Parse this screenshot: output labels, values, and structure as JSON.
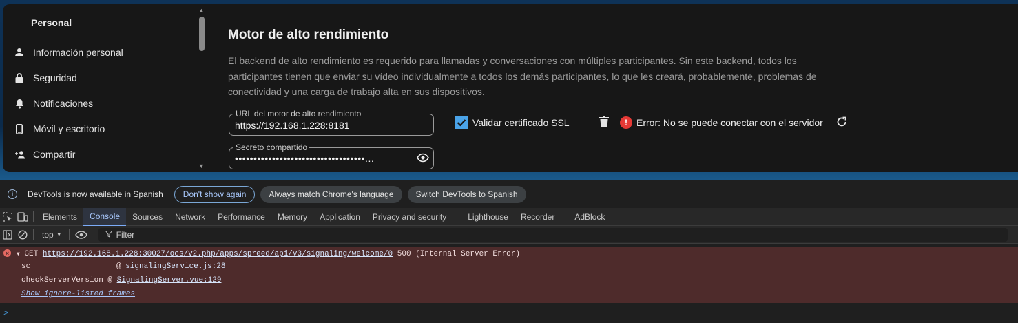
{
  "sidebar": {
    "title": "Personal",
    "items": [
      {
        "label": "Información personal",
        "icon": "user-icon"
      },
      {
        "label": "Seguridad",
        "icon": "lock-icon"
      },
      {
        "label": "Notificaciones",
        "icon": "bell-icon"
      },
      {
        "label": "Móvil y escritorio",
        "icon": "phone-icon"
      },
      {
        "label": "Compartir",
        "icon": "user-plus-icon"
      }
    ]
  },
  "main": {
    "title": "Motor de alto rendimiento",
    "description": "El backend de alto rendimiento es requerido para llamadas y conversaciones con múltiples participantes. Sin este backend, todos los participantes tienen que enviar su vídeo individualmente a todos los demás participantes, lo que les creará, probablemente, problemas de conectividad y una carga de trabajo alta en sus dispositivos.",
    "url_field": {
      "label": "URL del motor de alto rendimiento",
      "value": "https://192.168.1.228:8181"
    },
    "secret_field": {
      "label": "Secreto compartido",
      "value": "•••••••••••••••••••••••••••••••••••..."
    },
    "ssl_checkbox": {
      "label": "Validar certificado SSL",
      "checked": true
    },
    "error_text": "Error: No se puede conectar con el servidor"
  },
  "devtools": {
    "infobar": {
      "text": "DevTools is now available in Spanish",
      "dont_show": "Don't show again",
      "always_match": "Always match Chrome's language",
      "switch": "Switch DevTools to Spanish"
    },
    "tabs": [
      "Elements",
      "Console",
      "Sources",
      "Network",
      "Performance",
      "Memory",
      "Application",
      "Privacy and security",
      "Lighthouse",
      "Recorder",
      "AdBlock"
    ],
    "active_tab": "Console",
    "context": "top",
    "filter_placeholder": "Filter",
    "error": {
      "method": "GET",
      "url": "https://192.168.1.228:30027/ocs/v2.php/apps/spreed/api/v3/signaling/welcome/0",
      "status": "500 (Internal Server Error)",
      "frames": [
        {
          "fn": "sc",
          "src": "signalingService.js:28"
        },
        {
          "fn": "checkServerVersion",
          "src": "SignalingServer.vue:129"
        }
      ],
      "show_frames": "Show ignore-listed frames"
    },
    "prompt": ">"
  }
}
